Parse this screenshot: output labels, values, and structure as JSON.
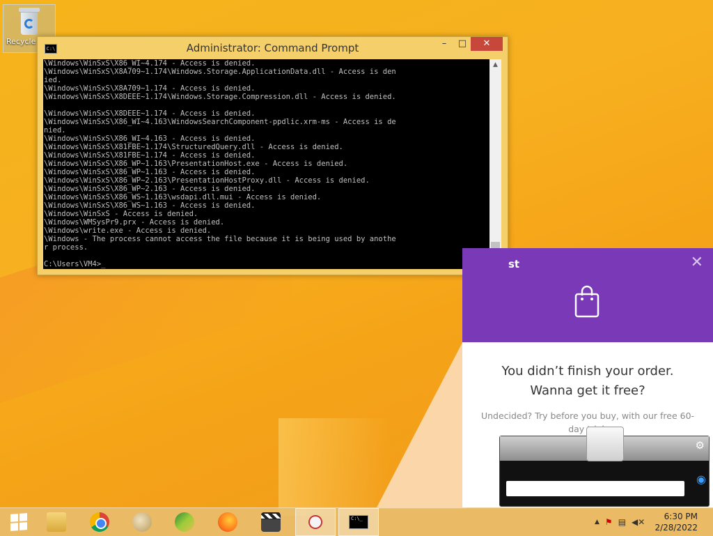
{
  "desktop": {
    "icons": [
      {
        "label": "Recycle",
        "icon": "recycle-bin-icon"
      }
    ]
  },
  "cmd_window": {
    "title": "Administrator: Command Prompt",
    "buttons": {
      "minimize": "–",
      "maximize": "□",
      "close": "✕"
    },
    "console_text": "\\Windows\\WinSxS\\X86_WI~4.174 - Access is denied.\n\\Windows\\WinSxS\\X8A709~1.174\\Windows.Storage.ApplicationData.dll - Access is den\nied.\n\\Windows\\WinSxS\\X8A709~1.174 - Access is denied.\n\\Windows\\WinSxS\\X8DEEE~1.174\\Windows.Storage.Compression.dll - Access is denied.\n\n\\Windows\\WinSxS\\X8DEEE~1.174 - Access is denied.\n\\Windows\\WinSxS\\X86_WI~4.163\\WindowsSearchComponent-ppdlic.xrm-ms - Access is de\nnied.\n\\Windows\\WinSxS\\X86_WI~4.163 - Access is denied.\n\\Windows\\WinSxS\\X81FBE~1.174\\StructuredQuery.dll - Access is denied.\n\\Windows\\WinSxS\\X81FBE~1.174 - Access is denied.\n\\Windows\\WinSxS\\X86_WP~1.163\\PresentationHost.exe - Access is denied.\n\\Windows\\WinSxS\\X86_WP~1.163 - Access is denied.\n\\Windows\\WinSxS\\X86_WP~2.163\\PresentationHostProxy.dll - Access is denied.\n\\Windows\\WinSxS\\X86_WP~2.163 - Access is denied.\n\\Windows\\WinSxS\\X86_WS~1.163\\wsdapi.dll.mui - Access is denied.\n\\Windows\\WinSxS\\X86_WS~1.163 - Access is denied.\n\\Windows\\WinSxS - Access is denied.\n\\Windows\\WMSysPr9.prx - Access is denied.\n\\Windows\\write.exe - Access is denied.\n\\Windows - The process cannot access the file because it is being used by anothe\nr process.\n\nC:\\Users\\VM4>_"
  },
  "promo": {
    "header_title": "st",
    "close": "✕",
    "bag_icon": "shopping-bag-icon",
    "accent": "#7a3ab8",
    "headline_1": "You didn’t finish your order.",
    "headline_2": "Wanna get it free?",
    "body": "Undecided? Try before you buy, with our free 60-day trial."
  },
  "widget": {
    "gear": "⚙",
    "input_value": ""
  },
  "taskbar": {
    "apps": [
      "start-button",
      "file-explorer-icon",
      "chrome-icon",
      "paint-icon",
      "maps-icon",
      "firefox-icon",
      "movie-maker-icon",
      "snipping-tool-icon",
      "command-prompt-icon"
    ],
    "tray_arrow": "▲",
    "time": "6:30 PM",
    "date": "2/28/2022"
  }
}
